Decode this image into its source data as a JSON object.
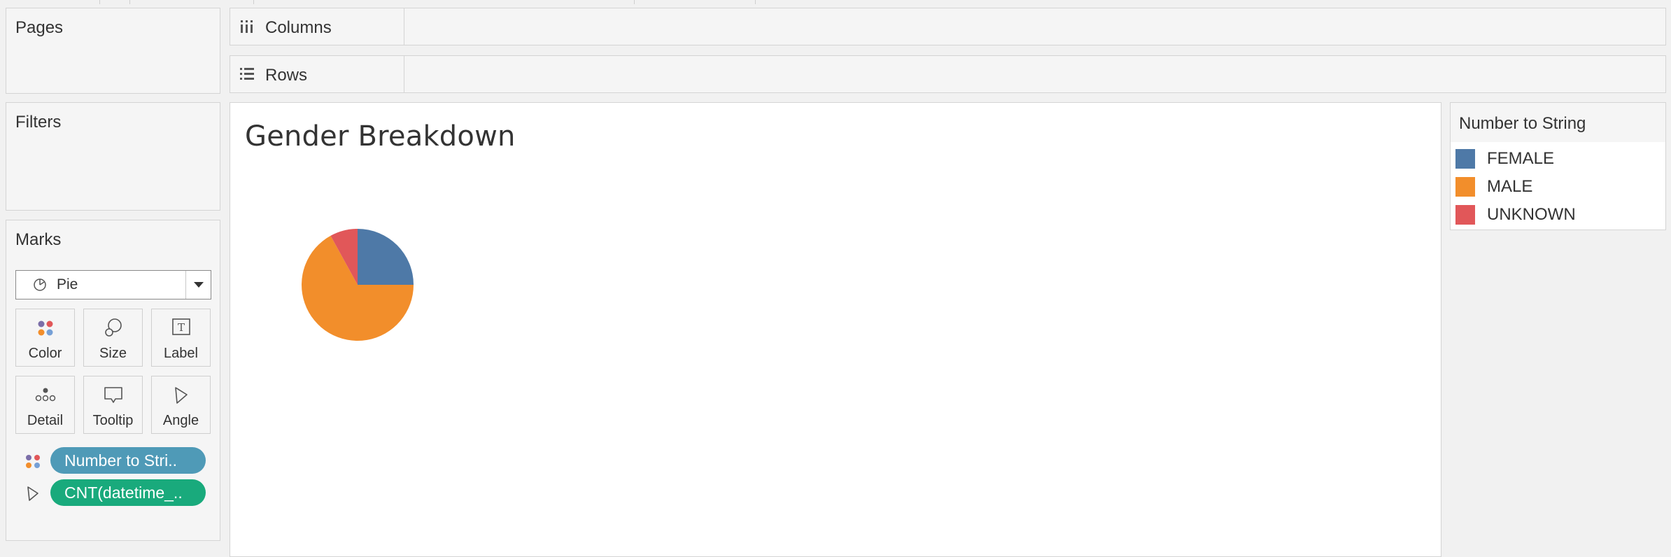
{
  "panels": {
    "pages_title": "Pages",
    "filters_title": "Filters",
    "marks_title": "Marks"
  },
  "shelves": {
    "columns_label": "Columns",
    "rows_label": "Rows"
  },
  "marks": {
    "mark_type": "Pie",
    "buttons": [
      "Color",
      "Size",
      "Label",
      "Detail",
      "Tooltip",
      "Angle"
    ],
    "pills": [
      {
        "label": "Number to Stri..",
        "color": "#4f9ab7",
        "encoding_icon": "color-icon"
      },
      {
        "label": "CNT(datetime_..",
        "color": "#19aa7c",
        "encoding_icon": "angle-icon"
      }
    ]
  },
  "view": {
    "title": "Gender Breakdown"
  },
  "legend": {
    "title": "Number to String",
    "items": [
      {
        "label": "FEMALE",
        "color": "#4e79a7"
      },
      {
        "label": "MALE",
        "color": "#f28e2b"
      },
      {
        "label": "UNKNOWN",
        "color": "#e15759"
      }
    ]
  },
  "chart_data": {
    "type": "pie",
    "title": "Gender Breakdown",
    "categories": [
      "FEMALE",
      "MALE",
      "UNKNOWN"
    ],
    "values": [
      25,
      67,
      8
    ],
    "colors": [
      "#4e79a7",
      "#f28e2b",
      "#e15759"
    ],
    "legend": "right"
  }
}
